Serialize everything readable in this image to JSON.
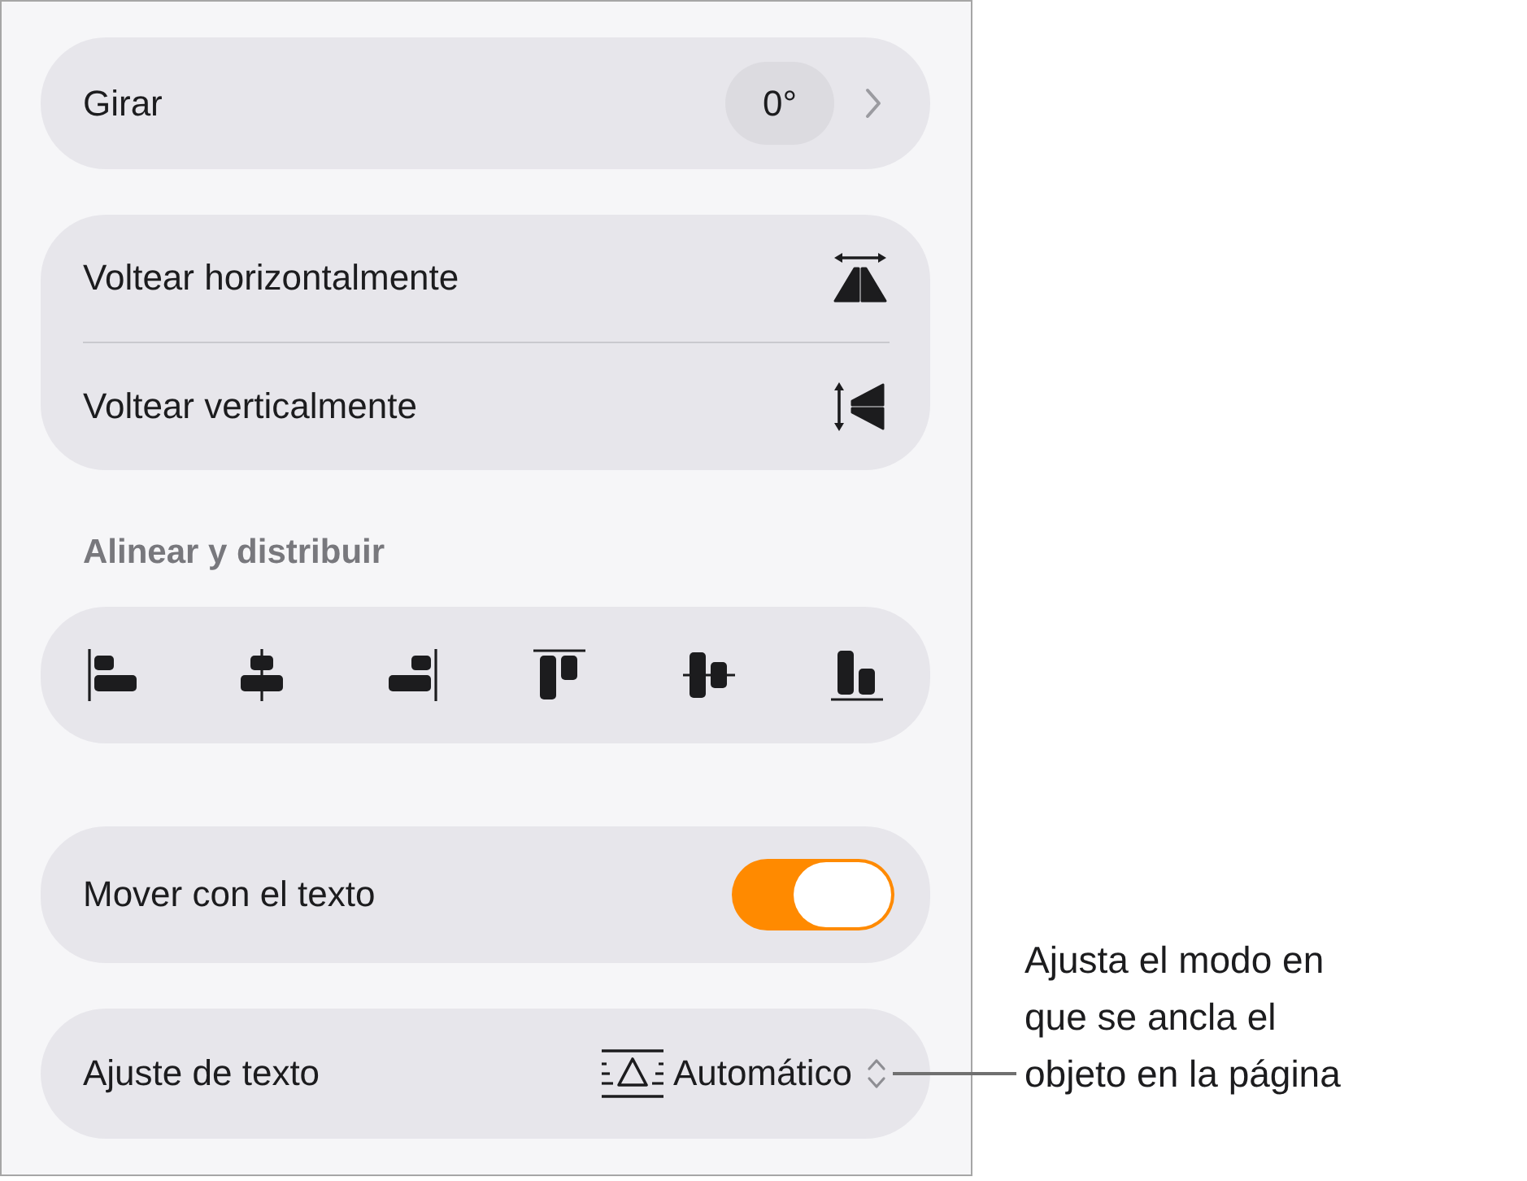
{
  "rotate": {
    "label": "Girar",
    "value": "0°"
  },
  "flip": [
    {
      "label": "Voltear horizontalmente",
      "kind": "horizontal"
    },
    {
      "label": "Voltear verticalmente",
      "kind": "vertical"
    }
  ],
  "align": {
    "heading": "Alinear y distribuir",
    "buttons": [
      {
        "kind": "left"
      },
      {
        "kind": "center"
      },
      {
        "kind": "right"
      },
      {
        "kind": "top"
      },
      {
        "kind": "middle"
      },
      {
        "kind": "bottom"
      }
    ]
  },
  "move_with_text": {
    "label": "Mover con el texto",
    "on": true
  },
  "text_wrap": {
    "label": "Ajuste de texto",
    "value": "Automático"
  },
  "callout": {
    "lines": [
      "Ajusta el modo en",
      "que se ancla el",
      "objeto en la página"
    ]
  }
}
